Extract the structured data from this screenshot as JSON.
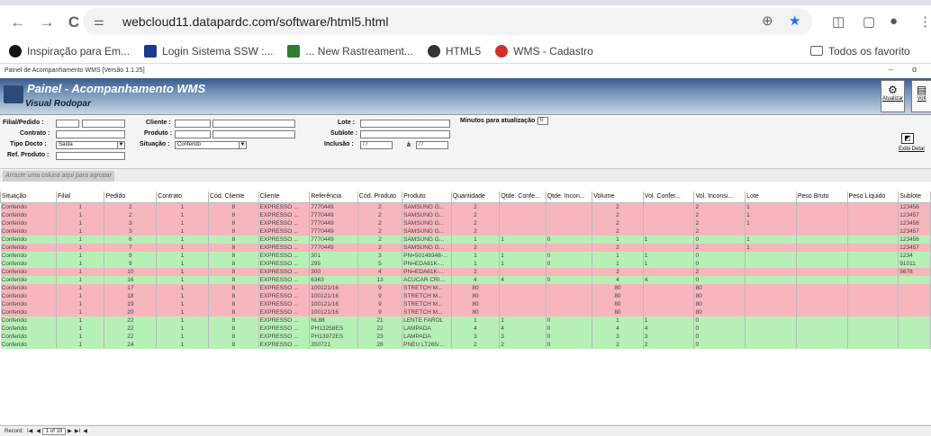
{
  "browser": {
    "url": "webcloud11.datapardc.com/software/html5.html",
    "nav": {
      "back": "←",
      "forward": "→",
      "reload": "C"
    },
    "right_icons": [
      "⊕",
      "★",
      "◫",
      "▢",
      "●",
      "⋮"
    ]
  },
  "bookmarks": [
    {
      "label": "Inspiração para Em...",
      "color": "#111111"
    },
    {
      "label": "Login Sistema SSW :...",
      "color": "#1a3a8c"
    },
    {
      "label": "... New Rastreament...",
      "color": "#2e7d32"
    },
    {
      "label": "HTML5",
      "color": "#333333"
    },
    {
      "label": "WMS - Cadastro",
      "color": "#d32f2f"
    }
  ],
  "bookmarks_folder": "Todos os favorito",
  "app": {
    "window_title": "Painel de Acompanhamento WMS [Versão 1.1.25]",
    "window_controls": {
      "min": "–",
      "max": "ɑ"
    },
    "banner_title": "Painel - Acompanhamento WMS",
    "banner_subtitle": "Visual Rodopar",
    "btn_atualizar": "Atualizar",
    "btn_voltar": "Volt"
  },
  "filters": {
    "filial_label": "Filial/Pedido :",
    "contrato_label": "Contrato :",
    "tipo_label": "Tipo Docto :",
    "tipo_value": "Saída",
    "refprod_label": "Ref. Produto :",
    "cliente_label": "Cliente :",
    "produto_label": "Produto :",
    "situacao_label": "Situação :",
    "situacao_value": "Conferido",
    "lote_label": "Lote :",
    "sublote_label": "Sublote :",
    "inclusao_label": "Inclusão :",
    "inclusao_from": "/ /",
    "inclusao_a": "à",
    "inclusao_to": "/ /",
    "minutos_label": "Minutos para atualização :",
    "minutos_value": "0",
    "exibir_label": "Exibi Detal"
  },
  "group_hint": "Arraste uma coluna aqui para agrupar",
  "grid": {
    "columns": [
      "Situação",
      "Filial",
      "Pedido",
      "Contrato",
      "Cód. Cliente",
      "Cliente",
      "Referência",
      "Cód. Produto",
      "Produto",
      "Quantidade",
      "Qtde. Confe...",
      "Qtde. Incon...",
      "Volume",
      "Vol. Confer...",
      "Vol. Inconsi...",
      "Lote",
      "Peso Bruto",
      "Peso Líquido",
      "Sublote"
    ],
    "rows": [
      {
        "c": "pink",
        "v": [
          "Conferido",
          "1",
          "2",
          "1",
          "8",
          "EXPRESSO ...",
          "7770449",
          "2",
          "SAMSUNG G...",
          "2",
          "",
          "",
          "2",
          "",
          "2",
          "1",
          "",
          "",
          "123456"
        ]
      },
      {
        "c": "pink",
        "v": [
          "Conferido",
          "1",
          "2",
          "1",
          "8",
          "EXPRESSO ...",
          "7770449",
          "2",
          "SAMSUNG G...",
          "2",
          "",
          "",
          "2",
          "",
          "2",
          "1",
          "",
          "",
          "123457"
        ]
      },
      {
        "c": "pink",
        "v": [
          "Conferido",
          "1",
          "3",
          "1",
          "8",
          "EXPRESSO ...",
          "7770449",
          "2",
          "SAMSUNG G...",
          "2",
          "",
          "",
          "2",
          "",
          "2",
          "1",
          "",
          "",
          "123456"
        ]
      },
      {
        "c": "pink",
        "v": [
          "Conferido",
          "1",
          "3",
          "1",
          "8",
          "EXPRESSO ...",
          "7770449",
          "2",
          "SAMSUNG G...",
          "2",
          "",
          "",
          "2",
          "",
          "2",
          "",
          "",
          "",
          "123457"
        ]
      },
      {
        "c": "green",
        "v": [
          "Conferido",
          "1",
          "6",
          "1",
          "8",
          "EXPRESSO ...",
          "7770449",
          "2",
          "SAMSUNG G...",
          "1",
          "1",
          "0",
          "1",
          "1",
          "0",
          "1",
          "",
          "",
          "123456"
        ]
      },
      {
        "c": "pink",
        "v": [
          "Conferido",
          "1",
          "7",
          "1",
          "8",
          "EXPRESSO ...",
          "7770449",
          "2",
          "SAMSUNG G...",
          "2",
          "",
          "",
          "2",
          "",
          "2",
          "1",
          "",
          "",
          "123457"
        ]
      },
      {
        "c": "green",
        "v": [
          "Conferido",
          "1",
          "9",
          "1",
          "8",
          "EXPRESSO ...",
          "301",
          "3",
          "PN=50149348-...",
          "1",
          "1",
          "0",
          "1",
          "1",
          "0",
          "",
          "",
          "",
          "1234"
        ]
      },
      {
        "c": "green",
        "v": [
          "Conferido",
          "1",
          "9",
          "1",
          "8",
          "EXPRESSO ...",
          "295",
          "5",
          "PN=EDA61K-...",
          "1",
          "1",
          "0",
          "1",
          "1",
          "0",
          "",
          "",
          "",
          "91011"
        ]
      },
      {
        "c": "pink",
        "v": [
          "Conferido",
          "1",
          "10",
          "1",
          "8",
          "EXPRESSO ...",
          "300",
          "4",
          "PN=EDA61K-...",
          "2",
          "",
          "",
          "2",
          "",
          "2",
          "",
          "",
          "",
          "5678"
        ]
      },
      {
        "c": "green",
        "v": [
          "Conferido",
          "1",
          "16",
          "1",
          "8",
          "EXPRESSO ...",
          "6363",
          "13",
          "ACUCAR CRI...",
          "4",
          "4",
          "0",
          "4",
          "4",
          "0",
          "",
          "",
          "",
          ""
        ]
      },
      {
        "c": "pink",
        "v": [
          "Conferido",
          "1",
          "17",
          "1",
          "8",
          "EXPRESSO ...",
          "100121/16",
          "9",
          "STRETCH M...",
          "80",
          "",
          "",
          "80",
          "",
          "80",
          "",
          "",
          "",
          ""
        ]
      },
      {
        "c": "pink",
        "v": [
          "Conferido",
          "1",
          "18",
          "1",
          "8",
          "EXPRESSO ...",
          "100121/16",
          "9",
          "STRETCH M...",
          "80",
          "",
          "",
          "80",
          "",
          "80",
          "",
          "",
          "",
          ""
        ]
      },
      {
        "c": "pink",
        "v": [
          "Conferido",
          "1",
          "19",
          "1",
          "8",
          "EXPRESSO ...",
          "100121/16",
          "9",
          "STRETCH M...",
          "80",
          "",
          "",
          "80",
          "",
          "80",
          "",
          "",
          "",
          ""
        ]
      },
      {
        "c": "pink",
        "v": [
          "Conferido",
          "1",
          "20",
          "1",
          "8",
          "EXPRESSO ...",
          "100121/16",
          "9",
          "STRETCH M...",
          "80",
          "",
          "",
          "80",
          "",
          "80",
          "",
          "",
          "",
          ""
        ]
      },
      {
        "c": "green",
        "v": [
          "Conferido",
          "1",
          "22",
          "1",
          "8",
          "EXPRESSO ...",
          "NL88",
          "21",
          "LENTE FAROL",
          "1",
          "1",
          "0",
          "1",
          "1",
          "0",
          "",
          "",
          "",
          ""
        ]
      },
      {
        "c": "green",
        "v": [
          "Conferido",
          "1",
          "22",
          "1",
          "8",
          "EXPRESSO ...",
          "PH13258ES",
          "22",
          "LAMPADA",
          "4",
          "4",
          "0",
          "4",
          "4",
          "0",
          "",
          "",
          "",
          ""
        ]
      },
      {
        "c": "green",
        "v": [
          "Conferido",
          "1",
          "22",
          "1",
          "8",
          "EXPRESSO ...",
          "PH13972ES",
          "23",
          "LAMPADA",
          "3",
          "3",
          "0",
          "3",
          "3",
          "0",
          "",
          "",
          "",
          ""
        ]
      },
      {
        "c": "green",
        "v": [
          "Conferido",
          "1",
          "24",
          "1",
          "8",
          "EXPRESSO ...",
          "350721",
          "28",
          "PNEU LT265/...",
          "2",
          "2",
          "0",
          "2",
          "2",
          "0",
          "",
          "",
          "",
          ""
        ]
      }
    ]
  },
  "status": {
    "record_label": "Record:",
    "first": "I◀",
    "prev": "◀",
    "page": "1 of 18",
    "next": "▶",
    "last": "▶I",
    "add": "◀"
  }
}
